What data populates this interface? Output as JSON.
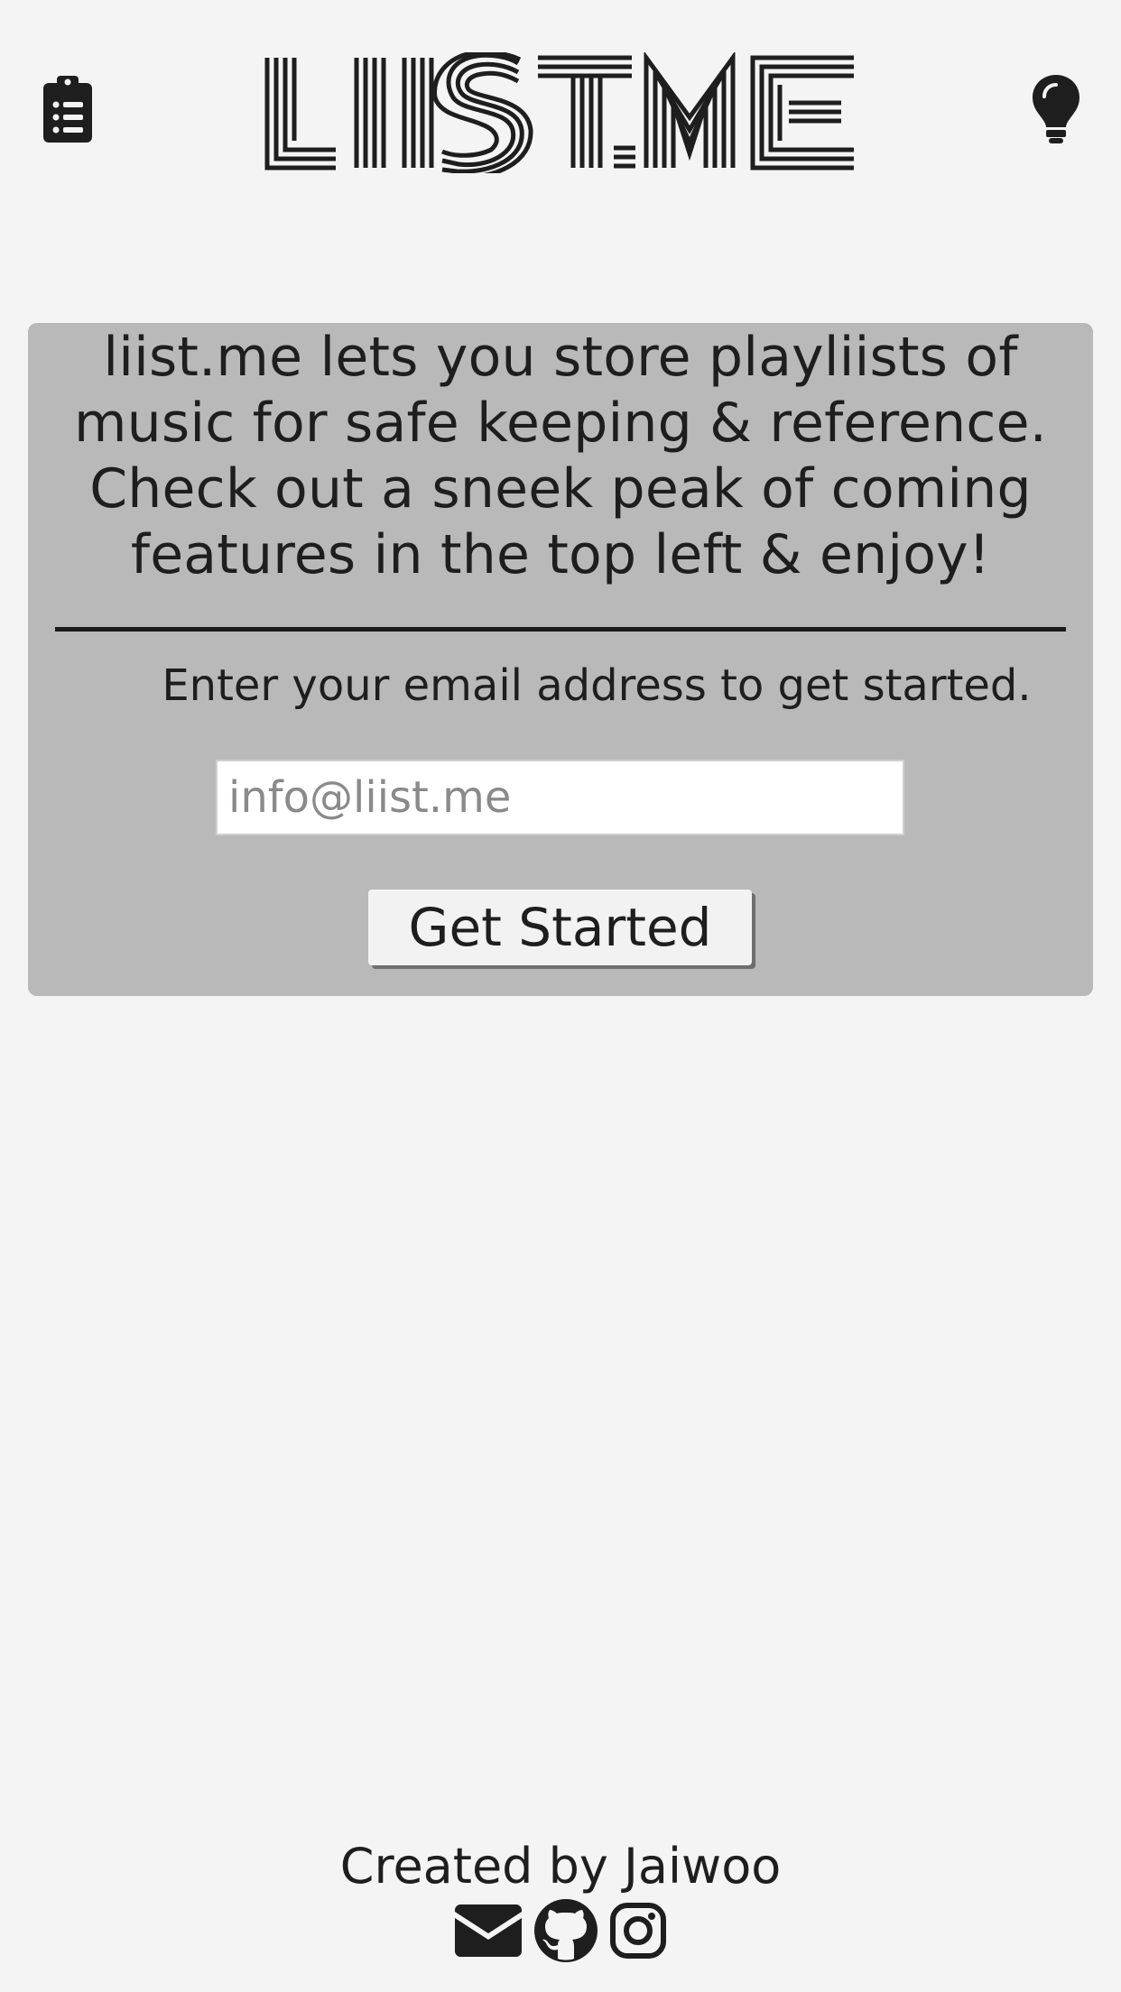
{
  "header": {
    "logo_text": "LIIST.ME",
    "left_icon": "clipboard-list-icon",
    "right_icon": "lightbulb-icon"
  },
  "card": {
    "intro": "liist.me lets you store playliists of music for safe keeping & reference. Check out a sneek peak of coming features in the top left & enjoy!",
    "prompt": "Enter your email address to get started.",
    "email_placeholder": "info@liist.me",
    "email_value": "",
    "button_label": "Get Started"
  },
  "footer": {
    "credit": "Created by Jaiwoo",
    "social_icons": [
      "envelope-icon",
      "github-icon",
      "instagram-icon"
    ]
  },
  "colors": {
    "background": "#f4f4f4",
    "card": "#b9b9b9",
    "text": "#1e1e1e",
    "divider": "#1b1b1b"
  }
}
